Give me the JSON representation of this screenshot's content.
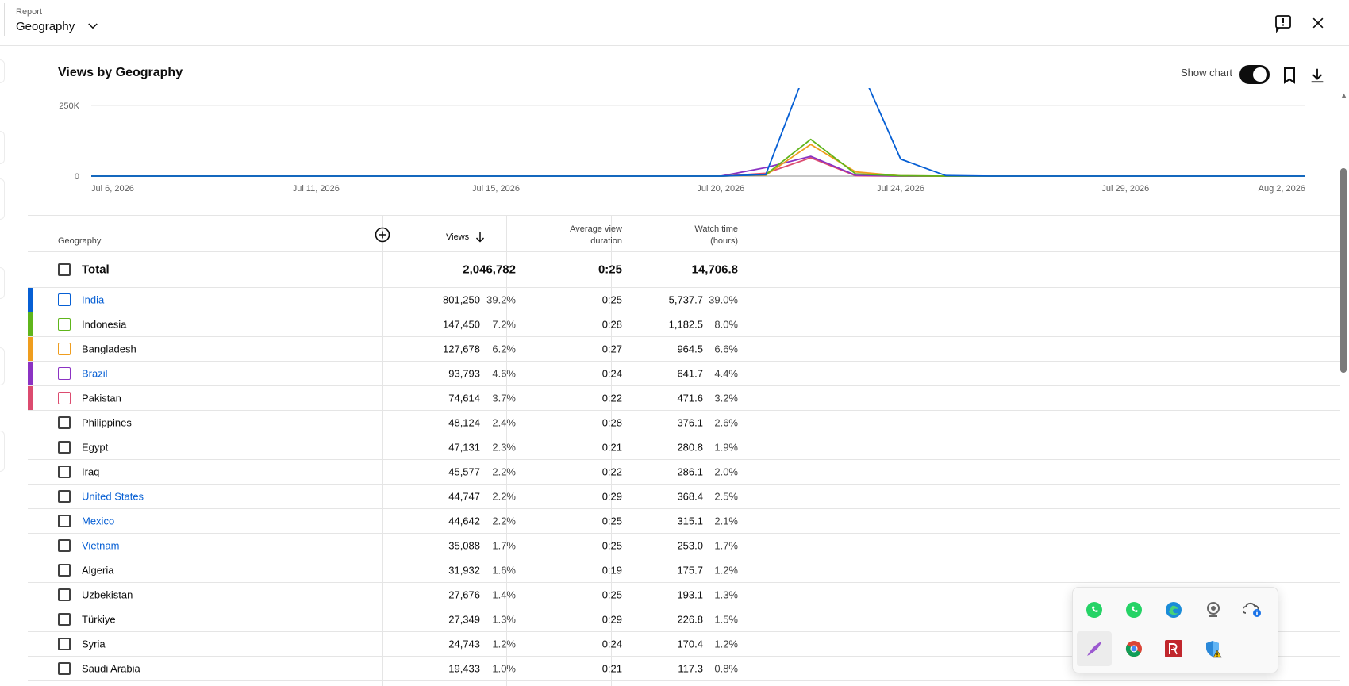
{
  "header": {
    "report_label": "Report",
    "report_value": "Geography",
    "feedback_icon": "feedback-icon",
    "close_icon": "close-icon"
  },
  "section": {
    "title": "Views by Geography",
    "show_chart_label": "Show chart",
    "show_chart_on": true,
    "bookmark_icon": "bookmark-icon",
    "download_icon": "download-icon"
  },
  "chart_data": {
    "type": "line",
    "x_tick_labels": [
      "Jul 6, 2026",
      "Jul 11, 2026",
      "Jul 15, 2026",
      "Jul 20, 2026",
      "Jul 24, 2026",
      "Jul 29, 2026",
      "Aug 2, 2026"
    ],
    "y_tick_labels": [
      "250K",
      "0"
    ],
    "ylim": [
      0,
      250000
    ],
    "x": [
      "Jul 6",
      "Jul 7",
      "Jul 8",
      "Jul 9",
      "Jul 10",
      "Jul 11",
      "Jul 12",
      "Jul 13",
      "Jul 14",
      "Jul 15",
      "Jul 16",
      "Jul 17",
      "Jul 18",
      "Jul 19",
      "Jul 20",
      "Jul 21",
      "Jul 22",
      "Jul 23",
      "Jul 24",
      "Jul 25",
      "Jul 26",
      "Jul 27",
      "Jul 28",
      "Jul 29",
      "Jul 30",
      "Jul 31",
      "Aug 1",
      "Aug 2"
    ],
    "series": [
      {
        "color": "#065fd4",
        "values": [
          0,
          0,
          0,
          0,
          0,
          0,
          0,
          0,
          0,
          0,
          0,
          0,
          0,
          0,
          0,
          5000,
          420000,
          420000,
          60000,
          2000,
          0,
          0,
          0,
          0,
          0,
          0,
          0,
          0
        ]
      },
      {
        "color": "#5fb51b",
        "values": [
          0,
          0,
          0,
          0,
          0,
          0,
          0,
          0,
          0,
          0,
          0,
          0,
          0,
          0,
          0,
          5000,
          130000,
          8000,
          1000,
          0,
          0,
          0,
          0,
          0,
          0,
          0,
          0,
          0
        ]
      },
      {
        "color": "#ef9d1e",
        "values": [
          0,
          0,
          0,
          0,
          0,
          0,
          0,
          0,
          0,
          0,
          0,
          0,
          0,
          0,
          0,
          3000,
          112000,
          15000,
          1000,
          0,
          0,
          0,
          0,
          0,
          0,
          0,
          0,
          0
        ]
      },
      {
        "color": "#8b32c3",
        "values": [
          0,
          0,
          0,
          0,
          0,
          0,
          0,
          0,
          0,
          0,
          0,
          0,
          0,
          0,
          0,
          30000,
          70000,
          3000,
          0,
          0,
          0,
          0,
          0,
          0,
          0,
          0,
          0,
          0
        ]
      },
      {
        "color": "#dc4b6f",
        "values": [
          0,
          0,
          0,
          0,
          0,
          0,
          0,
          0,
          0,
          0,
          0,
          0,
          0,
          0,
          0,
          10000,
          65000,
          1000,
          0,
          0,
          0,
          0,
          0,
          0,
          0,
          0,
          0,
          0
        ]
      }
    ],
    "grid": true
  },
  "table": {
    "headers": {
      "geography": "Geography",
      "views": "Views",
      "avg_line1": "Average view",
      "avg_line2": "duration",
      "watch_line1": "Watch time",
      "watch_line2": "(hours)"
    },
    "total": {
      "name": "Total",
      "views": "2,046,782",
      "avg": "0:25",
      "watch": "14,706.8"
    },
    "rows": [
      {
        "name": "India",
        "link": true,
        "color": "#065fd4",
        "views": "801,250",
        "vpct": "39.2%",
        "avg": "0:25",
        "watch": "5,737.7",
        "wpct": "39.0%"
      },
      {
        "name": "Indonesia",
        "link": false,
        "color": "#5fb51b",
        "views": "147,450",
        "vpct": "7.2%",
        "avg": "0:28",
        "watch": "1,182.5",
        "wpct": "8.0%"
      },
      {
        "name": "Bangladesh",
        "link": false,
        "color": "#ef9d1e",
        "views": "127,678",
        "vpct": "6.2%",
        "avg": "0:27",
        "watch": "964.5",
        "wpct": "6.6%"
      },
      {
        "name": "Brazil",
        "link": true,
        "color": "#8b32c3",
        "views": "93,793",
        "vpct": "4.6%",
        "avg": "0:24",
        "watch": "641.7",
        "wpct": "4.4%"
      },
      {
        "name": "Pakistan",
        "link": false,
        "color": "#dc4b6f",
        "views": "74,614",
        "vpct": "3.7%",
        "avg": "0:22",
        "watch": "471.6",
        "wpct": "3.2%"
      },
      {
        "name": "Philippines",
        "link": false,
        "color": "",
        "views": "48,124",
        "vpct": "2.4%",
        "avg": "0:28",
        "watch": "376.1",
        "wpct": "2.6%"
      },
      {
        "name": "Egypt",
        "link": false,
        "color": "",
        "views": "47,131",
        "vpct": "2.3%",
        "avg": "0:21",
        "watch": "280.8",
        "wpct": "1.9%"
      },
      {
        "name": "Iraq",
        "link": false,
        "color": "",
        "views": "45,577",
        "vpct": "2.2%",
        "avg": "0:22",
        "watch": "286.1",
        "wpct": "2.0%"
      },
      {
        "name": "United States",
        "link": true,
        "color": "",
        "views": "44,747",
        "vpct": "2.2%",
        "avg": "0:29",
        "watch": "368.4",
        "wpct": "2.5%"
      },
      {
        "name": "Mexico",
        "link": true,
        "color": "",
        "views": "44,642",
        "vpct": "2.2%",
        "avg": "0:25",
        "watch": "315.1",
        "wpct": "2.1%"
      },
      {
        "name": "Vietnam",
        "link": true,
        "color": "",
        "views": "35,088",
        "vpct": "1.7%",
        "avg": "0:25",
        "watch": "253.0",
        "wpct": "1.7%"
      },
      {
        "name": "Algeria",
        "link": false,
        "color": "",
        "views": "31,932",
        "vpct": "1.6%",
        "avg": "0:19",
        "watch": "175.7",
        "wpct": "1.2%"
      },
      {
        "name": "Uzbekistan",
        "link": false,
        "color": "",
        "views": "27,676",
        "vpct": "1.4%",
        "avg": "0:25",
        "watch": "193.1",
        "wpct": "1.3%"
      },
      {
        "name": "Türkiye",
        "link": false,
        "color": "",
        "views": "27,349",
        "vpct": "1.3%",
        "avg": "0:29",
        "watch": "226.8",
        "wpct": "1.5%"
      },
      {
        "name": "Syria",
        "link": false,
        "color": "",
        "views": "24,743",
        "vpct": "1.2%",
        "avg": "0:24",
        "watch": "170.4",
        "wpct": "1.2%"
      },
      {
        "name": "Saudi Arabia",
        "link": false,
        "color": "",
        "views": "19,433",
        "vpct": "1.0%",
        "avg": "0:21",
        "watch": "117.3",
        "wpct": "0.8%"
      }
    ]
  },
  "tray": {
    "icons": [
      "whatsapp-icon",
      "whatsapp-icon",
      "edge-icon",
      "webcam-icon",
      "onedrive-icon",
      "feather-icon",
      "chrome-icon",
      "pdf-reader-icon",
      "defender-warning-icon"
    ]
  }
}
